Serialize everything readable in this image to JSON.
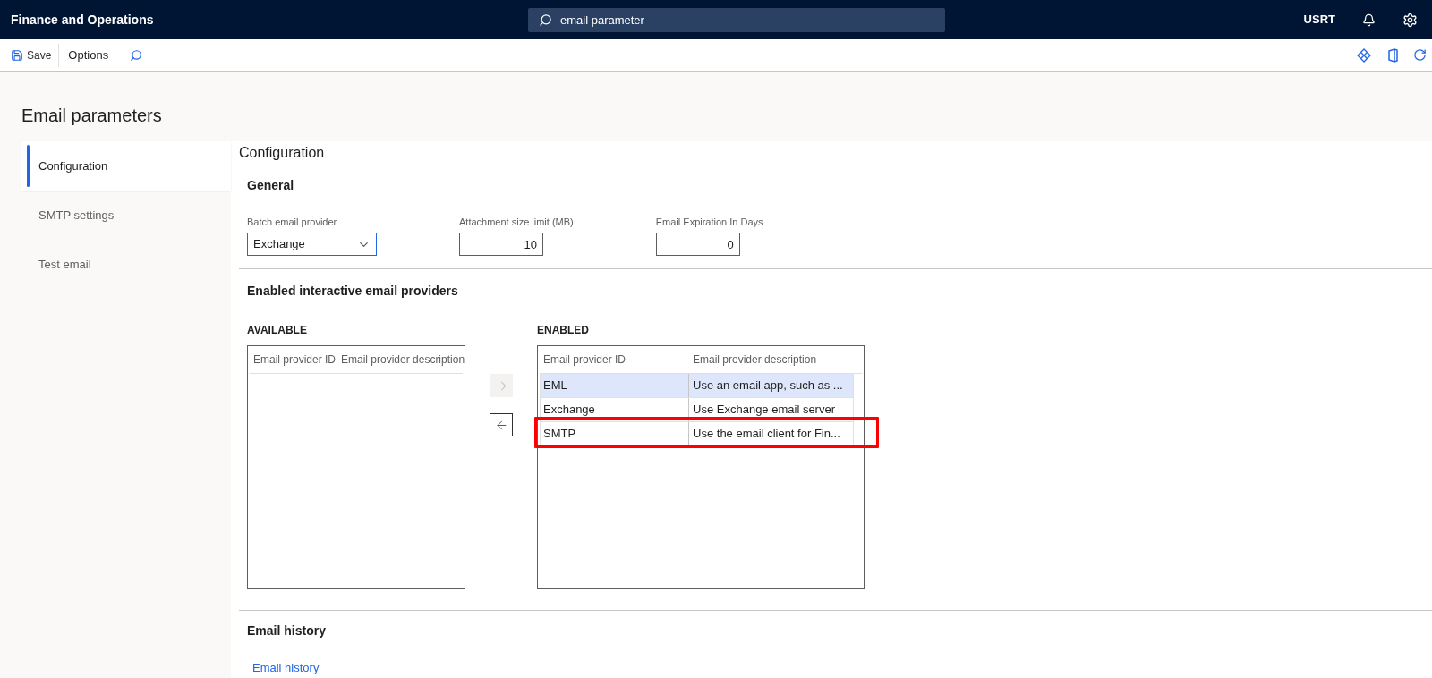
{
  "app_bar": {
    "title": "Finance and Operations",
    "search": {
      "value": "email parameter"
    },
    "company": "USRT"
  },
  "toolbar": {
    "save": "Save",
    "options": "Options"
  },
  "page_title": "Email parameters",
  "nav": [
    {
      "label": "Configuration",
      "selected": true
    },
    {
      "label": "SMTP settings",
      "selected": false
    },
    {
      "label": "Test email",
      "selected": false
    }
  ],
  "section_title": "Configuration",
  "general": {
    "title": "General",
    "fields": [
      {
        "kind": "dropdown",
        "label": "Batch email provider",
        "value": "Exchange"
      },
      {
        "kind": "number",
        "label": "Attachment size limit (MB)",
        "value": "10"
      },
      {
        "kind": "number",
        "label": "Email Expiration In Days",
        "value": "0"
      }
    ]
  },
  "providers": {
    "title": "Enabled interactive email providers",
    "available": {
      "title": "AVAILABLE",
      "columns": [
        "Email provider ID",
        "Email provider description"
      ]
    },
    "move_buttons": [
      {
        "kind": "right",
        "disabled": true
      },
      {
        "kind": "left",
        "disabled": false
      }
    ],
    "enabled": {
      "title": "ENABLED",
      "columns": [
        "Email provider ID",
        "Email provider description"
      ],
      "rows": [
        {
          "id": "EML",
          "description": "Use an email app, such as ...",
          "selected": true,
          "highlighted": false
        },
        {
          "id": "Exchange",
          "description": "Use Exchange email server",
          "selected": false,
          "highlighted": false
        },
        {
          "id": "SMTP",
          "description": "Use the email client for Fin...",
          "selected": false,
          "highlighted": true
        }
      ]
    }
  },
  "history": {
    "title": "Email history",
    "link": "Email history"
  }
}
